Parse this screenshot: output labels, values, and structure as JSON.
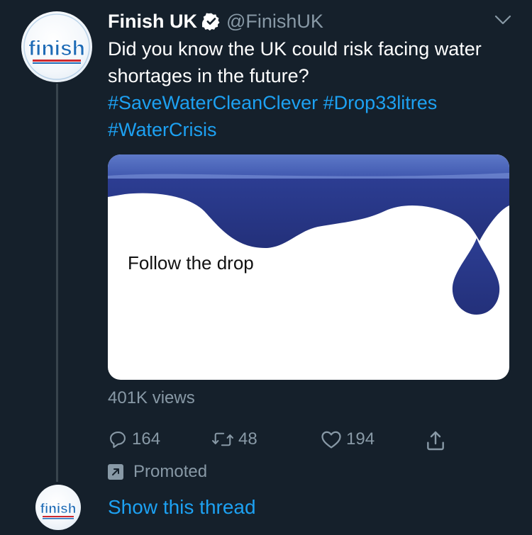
{
  "tweet": {
    "author_name": "Finish UK",
    "handle": "@FinishUK",
    "text": "Did you know the UK could risk facing water shortages in the future?",
    "hashtags": [
      "#SaveWaterCleanClever",
      "#Drop33litres",
      "#WaterCrisis"
    ],
    "avatar_logo": "finish",
    "media": {
      "caption": "Follow the drop"
    },
    "views": "401K views",
    "actions": {
      "replies": "164",
      "retweets": "48",
      "likes": "194"
    },
    "promoted_label": "Promoted"
  },
  "thread": {
    "avatar_logo": "finish",
    "show_thread_label": "Show this thread"
  },
  "icons": {
    "verified": "verified-badge-icon",
    "caret": "chevron-down-icon",
    "reply": "reply-icon",
    "retweet": "retweet-icon",
    "like": "heart-icon",
    "share": "share-icon",
    "promoted": "promoted-arrow-icon"
  },
  "colors": {
    "background": "#15202b",
    "accent": "#1da1f2",
    "secondary_text": "#8899a6",
    "water": "#2b3a8c"
  }
}
